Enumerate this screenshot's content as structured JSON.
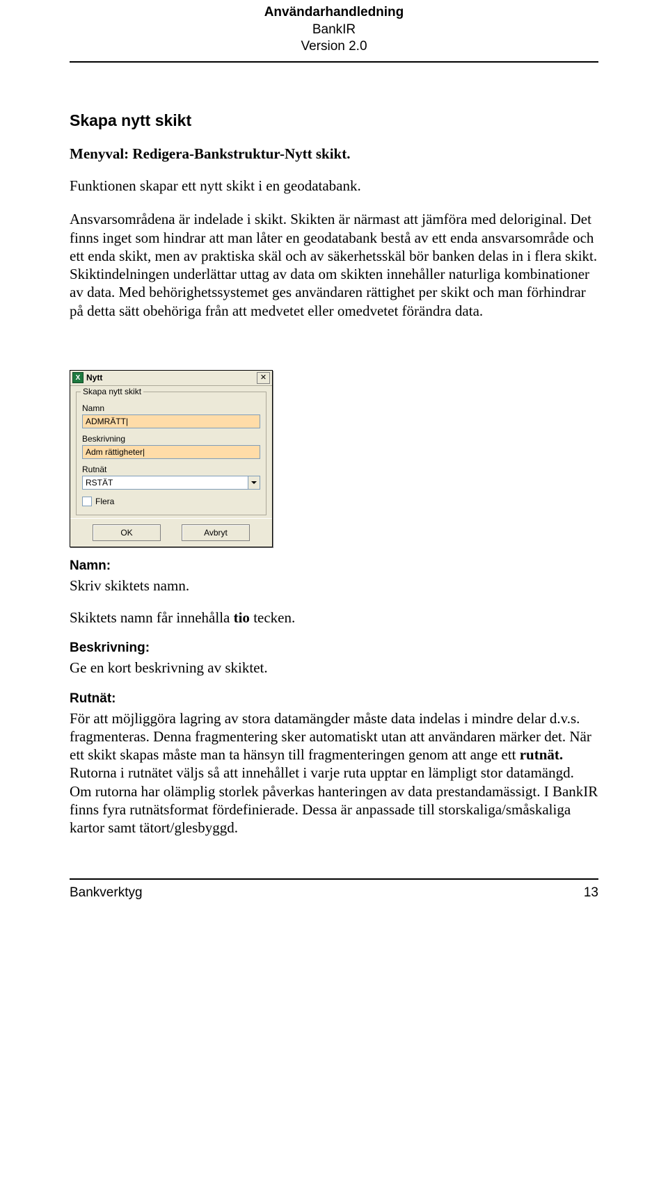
{
  "header": {
    "line1": "Användarhandledning",
    "line2": "BankIR",
    "line3": "Version 2.0"
  },
  "section": {
    "title": "Skapa nytt skikt",
    "menyval": "Menyval: Redigera-Bankstruktur-Nytt skikt.",
    "intro": "Funktionen skapar ett nytt skikt i en geodatabank.",
    "para": "Ansvarsområdena är indelade i skikt. Skikten är närmast att jämföra med deloriginal. Det finns inget som hindrar att man låter en geodatabank bestå av ett enda ansvarsområde och ett enda skikt, men av praktiska skäl och av säkerhetsskäl bör banken delas in i flera skikt. Skiktindelningen underlättar uttag av data om skikten innehåller naturliga kombinationer av data. Med behörighetssystemet ges användaren rättighet per skikt och man förhindrar på detta sätt obehöriga från att medvetet eller omedvetet förändra data."
  },
  "dialog": {
    "app_icon_letter": "X",
    "title": "Nytt",
    "group_legend": "Skapa nytt skikt",
    "labels": {
      "namn": "Namn",
      "beskrivning": "Beskrivning",
      "rutnat": "Rutnät"
    },
    "values": {
      "namn": "ADMRÄTT|",
      "beskrivning": "Adm rättigheter|",
      "rutnat": "RSTÄT"
    },
    "checkbox_label": "Flera",
    "buttons": {
      "ok": "OK",
      "cancel": "Avbryt"
    }
  },
  "fields": {
    "namn": {
      "label": "Namn:",
      "desc1": "Skriv skiktets namn.",
      "desc2_pre": "Skiktets namn får innehålla ",
      "desc2_bold": "tio",
      "desc2_post": " tecken."
    },
    "beskrivning": {
      "label": "Beskrivning:",
      "desc": "Ge en kort beskrivning av skiktet."
    },
    "rutnat": {
      "label": "Rutnät:",
      "desc_pre": "För att möjliggöra lagring av stora datamängder måste data indelas i mindre delar d.v.s. fragmenteras. Denna fragmentering sker automatiskt utan att användaren märker det. När ett skikt skapas måste man ta hänsyn till fragmenteringen genom att ange ett ",
      "desc_bold": "rutnät.",
      "desc_post": " Rutorna i rutnätet väljs så att innehållet i varje ruta upptar en lämpligt stor datamängd. Om rutorna har olämplig storlek påverkas hanteringen av data prestandamässigt. I BankIR finns fyra rutnätsformat fördefinierade. Dessa är anpassade till storskaliga/småskaliga kartor samt tätort/glesbyggd."
    }
  },
  "footer": {
    "left": "Bankverktyg",
    "right": "13"
  }
}
